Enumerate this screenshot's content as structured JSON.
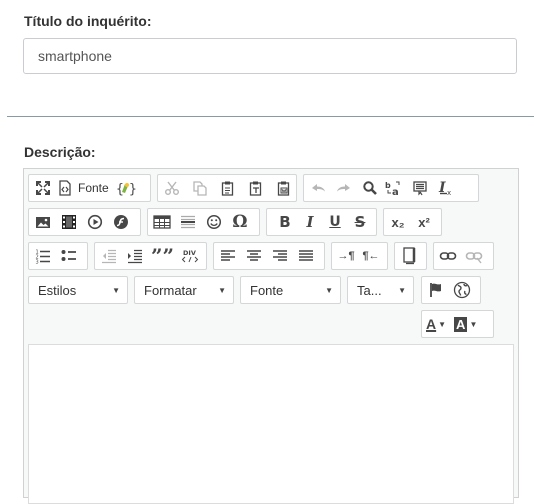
{
  "form": {
    "title_label": "Título do inquérito:",
    "title_value": "smartphone",
    "description_label": "Descrição:"
  },
  "toolbar": {
    "source_label": "Fonte",
    "bold": "B",
    "italic": "I",
    "underline": "U",
    "strike": "S",
    "subscript": "x₂",
    "superscript": "x²",
    "pilcrow_ltr": "→¶",
    "pilcrow_rtl": "¶←",
    "blockquote": "””",
    "omega": "Ω",
    "styles": "Estilos",
    "format": "Formatar",
    "font": "Fonte",
    "size": "Ta...",
    "text_color": "A",
    "bg_color": "A"
  },
  "icons": {
    "maximize": "maximize-icon",
    "source": "source-icon",
    "template": "template-icon",
    "cut": "cut-icon",
    "copy": "copy-icon",
    "paste": "paste-icon",
    "paste_text": "paste-text-icon",
    "paste_word": "paste-word-icon",
    "undo": "undo-icon",
    "redo": "redo-icon",
    "find": "find-icon",
    "replace": "replace-icon",
    "select_all": "select-all-icon",
    "remove_format": "remove-format-icon",
    "image": "image-icon",
    "video": "video-icon",
    "youtube": "play-circle-icon",
    "flash": "flash-icon",
    "table": "table-icon",
    "hline": "horizontal-line-icon",
    "smiley": "smiley-icon",
    "numbered_list": "numbered-list-icon",
    "bulleted_list": "bulleted-list-icon",
    "outdent": "outdent-icon",
    "indent": "indent-icon",
    "div": "div-icon",
    "align_left": "align-left-icon",
    "align_center": "align-center-icon",
    "align_right": "align-right-icon",
    "justify": "justify-icon",
    "show_blocks": "show-blocks-icon",
    "link": "link-icon",
    "unlink": "unlink-icon",
    "flag": "flag-icon",
    "globe": "globe-icon"
  },
  "colors": {
    "disabled_icon": "#b6b6b6",
    "icon": "#474747",
    "toolbar_bg": "#f7f8f8",
    "divider": "#8a9aa4"
  }
}
